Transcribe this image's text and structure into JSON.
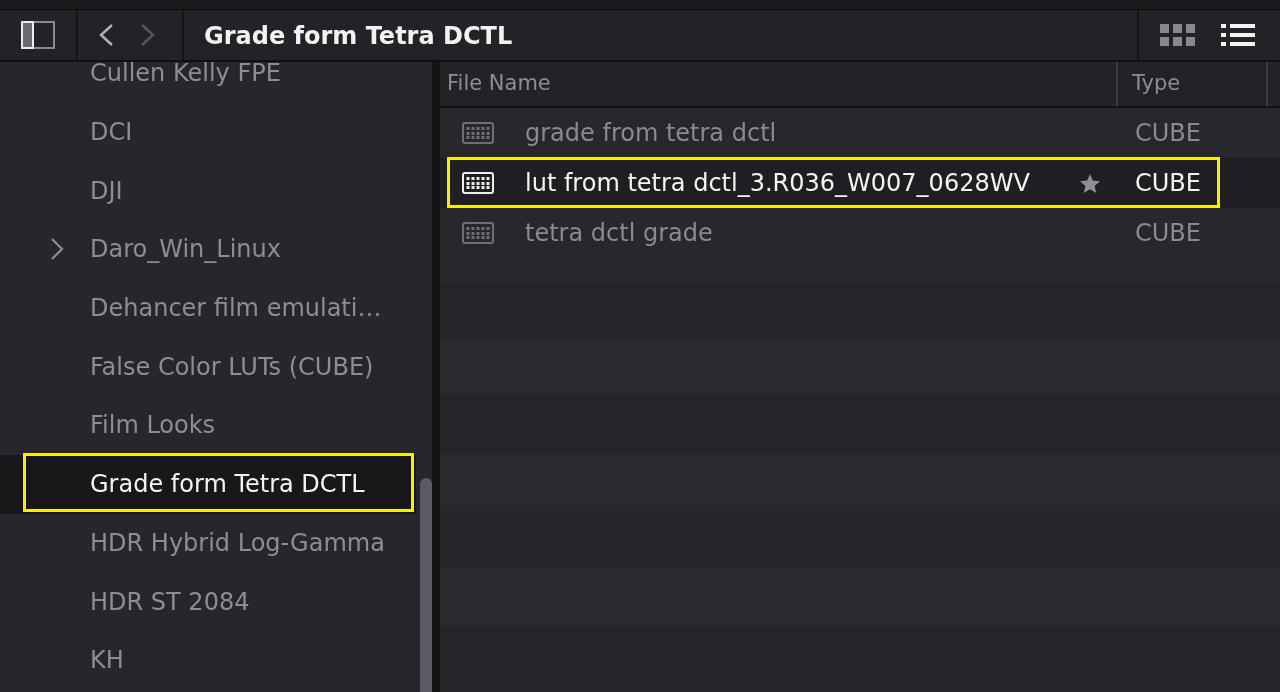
{
  "toolbar": {
    "sidebar_toggle": {
      "on": true
    },
    "back": {
      "disabled": false
    },
    "forward": {
      "disabled": true
    },
    "title": "Grade form Tetra DCTL",
    "view_modes": [
      {
        "kind": "grid",
        "selected": false
      },
      {
        "kind": "list",
        "selected": true
      }
    ]
  },
  "sidebar": {
    "items": [
      {
        "label": "Cullen Kelly FPE",
        "has_children": false,
        "selected": false,
        "annotated": false
      },
      {
        "label": "DCI",
        "has_children": false,
        "selected": false,
        "annotated": false
      },
      {
        "label": "DJI",
        "has_children": false,
        "selected": false,
        "annotated": false
      },
      {
        "label": "Daro_Win_Linux",
        "has_children": true,
        "selected": false,
        "annotated": false
      },
      {
        "label": "Dehancer film emulati…",
        "has_children": false,
        "selected": false,
        "annotated": false
      },
      {
        "label": "False Color LUTs (CUBE)",
        "has_children": false,
        "selected": false,
        "annotated": false
      },
      {
        "label": "Film Looks",
        "has_children": false,
        "selected": false,
        "annotated": false
      },
      {
        "label": "Grade form Tetra DCTL",
        "has_children": false,
        "selected": true,
        "annotated": true
      },
      {
        "label": "HDR Hybrid Log-Gamma",
        "has_children": false,
        "selected": false,
        "annotated": false
      },
      {
        "label": "HDR ST 2084",
        "has_children": false,
        "selected": false,
        "annotated": false
      },
      {
        "label": "KH",
        "has_children": false,
        "selected": false,
        "annotated": false
      }
    ]
  },
  "table": {
    "columns": [
      "File Name",
      "Type"
    ],
    "rows": [
      {
        "name": "grade from tetra dctl",
        "type": "CUBE",
        "selected": false,
        "starred": false,
        "annotated": false
      },
      {
        "name": "lut from tetra dctl_3.R036_W007_0628WV",
        "type": "CUBE",
        "selected": true,
        "starred": true,
        "annotated": true
      },
      {
        "name": "tetra dctl grade",
        "type": "CUBE",
        "selected": false,
        "starred": false,
        "annotated": false
      }
    ]
  }
}
